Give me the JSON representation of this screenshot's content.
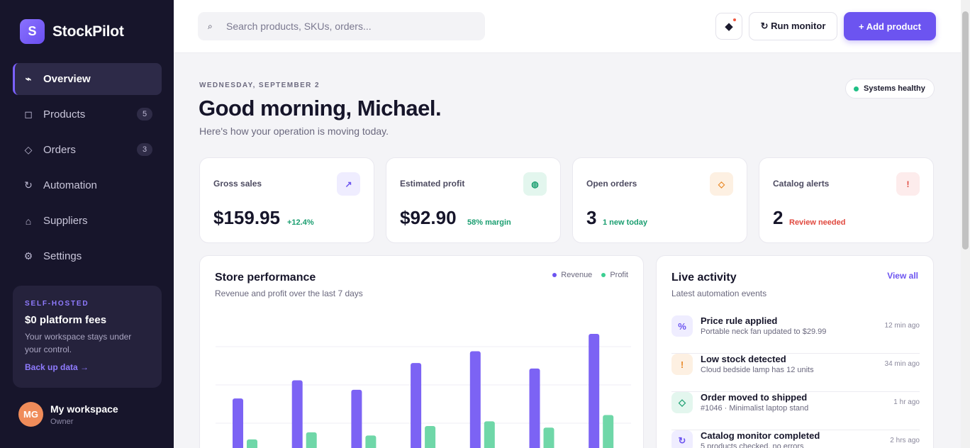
{
  "brand": {
    "logo_letter": "S",
    "name": "StockPilot"
  },
  "nav": {
    "items": [
      {
        "icon": "pulse-icon",
        "glyph": "⌁",
        "label": "Overview",
        "badge": ""
      },
      {
        "icon": "box-icon",
        "glyph": "◻",
        "label": "Products",
        "badge": "5"
      },
      {
        "icon": "diamond-icon",
        "glyph": "◇",
        "label": "Orders",
        "badge": "3"
      },
      {
        "icon": "refresh-icon",
        "glyph": "↻",
        "label": "Automation",
        "badge": ""
      },
      {
        "icon": "home-icon",
        "glyph": "⌂",
        "label": "Suppliers",
        "badge": ""
      },
      {
        "icon": "gear-icon",
        "glyph": "⚙",
        "label": "Settings",
        "badge": ""
      }
    ],
    "active": "Overview"
  },
  "promo": {
    "tag": "SELF-HOSTED",
    "title": "$0 platform fees",
    "text": "Your workspace stays under your control.",
    "link": "Back up data →"
  },
  "user": {
    "initials": "MG",
    "name": "My workspace",
    "role": "Owner"
  },
  "topbar": {
    "search_placeholder": "Search products, SKUs, orders...",
    "search_icon": "search-icon",
    "search_glyph": "⌕",
    "notify_glyph": "◆",
    "run_label": "↻ Run monitor",
    "add_label": "+ Add product"
  },
  "header": {
    "date": "WEDNESDAY, SEPTEMBER 2",
    "greeting": "Good morning, Michael.",
    "subtitle": "Here's how your operation is moving today.",
    "status": "Systems healthy"
  },
  "stats": [
    {
      "label": "Gross sales",
      "value": "$159.95",
      "delta": "+12.4%",
      "icon_glyph": "↗",
      "icon": "trend-up-icon",
      "tone": "#efedff",
      "ink": "#6c54f0",
      "delta_color": "#1a9e70"
    },
    {
      "label": "Estimated profit",
      "value": "$92.90",
      "delta": "58% margin",
      "icon_glyph": "◍",
      "icon": "coins-icon",
      "tone": "#e3f6ee",
      "ink": "#1a9e70",
      "delta_color": "#1a9e70"
    },
    {
      "label": "Open orders",
      "value": "3",
      "delta": "1 new today",
      "icon_glyph": "◇",
      "icon": "tag-icon",
      "tone": "#fdf0e2",
      "ink": "#e98a2a",
      "delta_color": "#1a9e70"
    },
    {
      "label": "Catalog alerts",
      "value": "2",
      "delta": "Review needed",
      "icon_glyph": "!",
      "icon": "alert-icon",
      "tone": "#fdecec",
      "ink": "#e0483e",
      "delta_color": "#e0483e"
    }
  ],
  "performance": {
    "title": "Store performance",
    "subtitle": "Revenue and profit over the last 7 days",
    "legend": [
      {
        "name": "Revenue",
        "color": "#6c54f0"
      },
      {
        "name": "Profit",
        "color": "#3ccf92"
      }
    ]
  },
  "chart_data": {
    "type": "bar",
    "categories": [
      "",
      "",
      "",
      "",
      "",
      "",
      ""
    ],
    "series": [
      {
        "name": "Revenue",
        "values": [
          80,
          103,
          91,
          125,
          140,
          118,
          162
        ]
      },
      {
        "name": "Profit",
        "values": [
          28,
          37,
          33,
          45,
          51,
          43,
          59
        ]
      }
    ],
    "title": "Store performance",
    "xlabel": "",
    "ylabel": "",
    "ylim": [
      0,
      180
    ],
    "grid": true,
    "legend": "top-right",
    "colors": {
      "Revenue": "#7c63f4",
      "Profit": "#6fd7a8"
    }
  },
  "activity": {
    "title": "Live activity",
    "subtitle": "Latest automation events",
    "view_all": "View all",
    "events": [
      {
        "title": "Price rule applied",
        "desc": "Portable neck fan updated to $29.99",
        "time": "12 min ago",
        "glyph": "%",
        "icon": "percent-icon",
        "tone": "#efedff",
        "ink": "#6c54f0"
      },
      {
        "title": "Low stock detected",
        "desc": "Cloud bedside lamp has 12 units",
        "time": "34 min ago",
        "glyph": "!",
        "icon": "alert-icon",
        "tone": "#fdf0e2",
        "ink": "#e98a2a"
      },
      {
        "title": "Order moved to shipped",
        "desc": "#1046 · Minimalist laptop stand",
        "time": "1 hr ago",
        "glyph": "◇",
        "icon": "diamond-icon",
        "tone": "#e3f6ee",
        "ink": "#1a9e70"
      },
      {
        "title": "Catalog monitor completed",
        "desc": "5 products checked, no errors",
        "time": "2 hrs ago",
        "glyph": "↻",
        "icon": "refresh-icon",
        "tone": "#efedff",
        "ink": "#6c54f0"
      }
    ]
  }
}
